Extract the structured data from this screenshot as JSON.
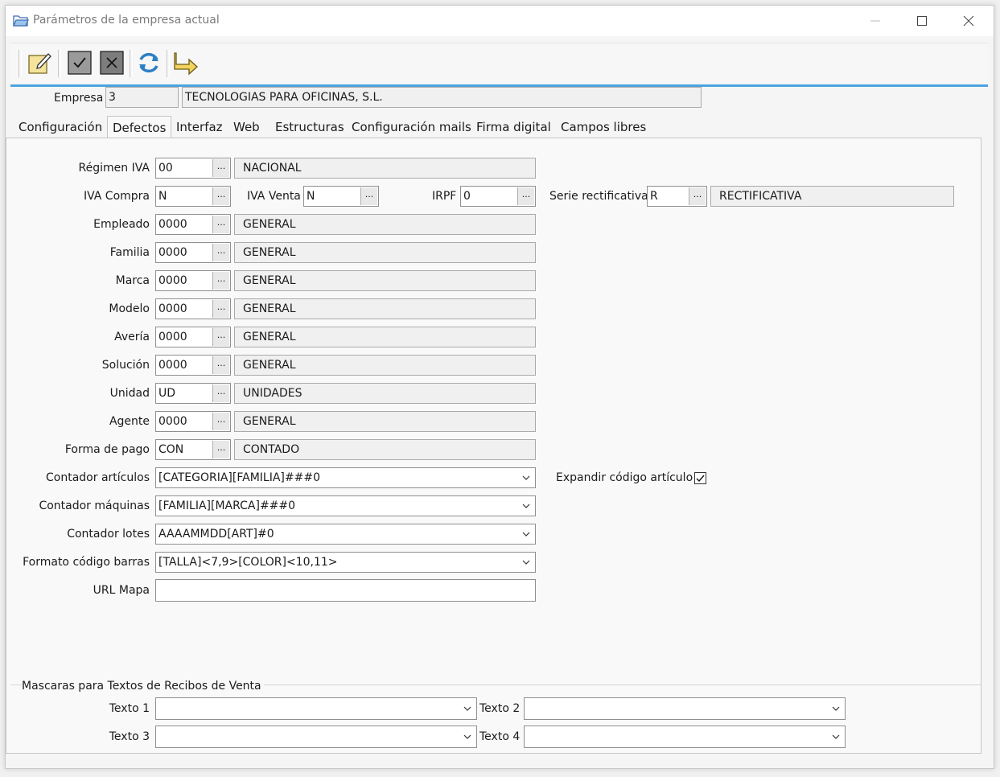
{
  "window": {
    "title": "Parámetros de la empresa actual"
  },
  "toolbar": {
    "edit": "edit-icon",
    "accept": "check-icon",
    "cancel": "x-icon",
    "refresh": "refresh-icon",
    "exit": "exit-arrow-icon"
  },
  "empresa": {
    "label": "Empresa",
    "code": "3",
    "name": "TECNOLOGIAS PARA OFICINAS, S.L."
  },
  "tabs": [
    {
      "label": "Configuración"
    },
    {
      "label": "Defectos"
    },
    {
      "label": "Interfaz"
    },
    {
      "label": "Web"
    },
    {
      "label": "Estructuras"
    },
    {
      "label": "Configuración mails"
    },
    {
      "label": "Firma digital"
    },
    {
      "label": "Campos libres"
    }
  ],
  "fields": {
    "regimen_iva": {
      "label": "Régimen IVA",
      "code": "00",
      "desc": "NACIONAL"
    },
    "iva_compra": {
      "label": "IVA Compra",
      "code": "N"
    },
    "iva_venta": {
      "label": "IVA Venta",
      "code": "N"
    },
    "irpf": {
      "label": "IRPF",
      "code": "0"
    },
    "serie_rect": {
      "label": "Serie rectificativa",
      "code": "R",
      "desc": "RECTIFICATIVA"
    },
    "empleado": {
      "label": "Empleado",
      "code": "0000",
      "desc": "GENERAL"
    },
    "familia": {
      "label": "Familia",
      "code": "0000",
      "desc": "GENERAL"
    },
    "marca": {
      "label": "Marca",
      "code": "0000",
      "desc": "GENERAL"
    },
    "modelo": {
      "label": "Modelo",
      "code": "0000",
      "desc": "GENERAL"
    },
    "averia": {
      "label": "Avería",
      "code": "0000",
      "desc": "GENERAL"
    },
    "solucion": {
      "label": "Solución",
      "code": "0000",
      "desc": "GENERAL"
    },
    "unidad": {
      "label": "Unidad",
      "code": "UD",
      "desc": "UNIDADES"
    },
    "agente": {
      "label": "Agente",
      "code": "0000",
      "desc": "GENERAL"
    },
    "forma_pago": {
      "label": "Forma de pago",
      "code": "CON",
      "desc": "CONTADO"
    },
    "dots": "...",
    "contador_articulos": {
      "label": "Contador artículos",
      "value": "[CATEGORIA][FAMILIA]###0"
    },
    "expandir": {
      "label": "Expandir código artículo",
      "checked": true
    },
    "contador_maquinas": {
      "label": "Contador máquinas",
      "value": "[FAMILIA][MARCA]###0"
    },
    "contador_lotes": {
      "label": "Contador lotes",
      "value": "AAAAMMDD[ART]#0"
    },
    "formato_barras": {
      "label": "Formato código barras",
      "value": "[TALLA]<7,9>[COLOR]<10,11>"
    },
    "url_mapa": {
      "label": "URL Mapa",
      "value": ""
    }
  },
  "mascaras": {
    "title": "Mascaras para Textos de Recibos de Venta",
    "texto1": {
      "label": "Texto 1",
      "value": ""
    },
    "texto2": {
      "label": "Texto 2",
      "value": ""
    },
    "texto3": {
      "label": "Texto 3",
      "value": ""
    },
    "texto4": {
      "label": "Texto 4",
      "value": ""
    }
  },
  "colors": {
    "accent": "#4aa3df",
    "readonly_bg": "#f0f0f0"
  }
}
